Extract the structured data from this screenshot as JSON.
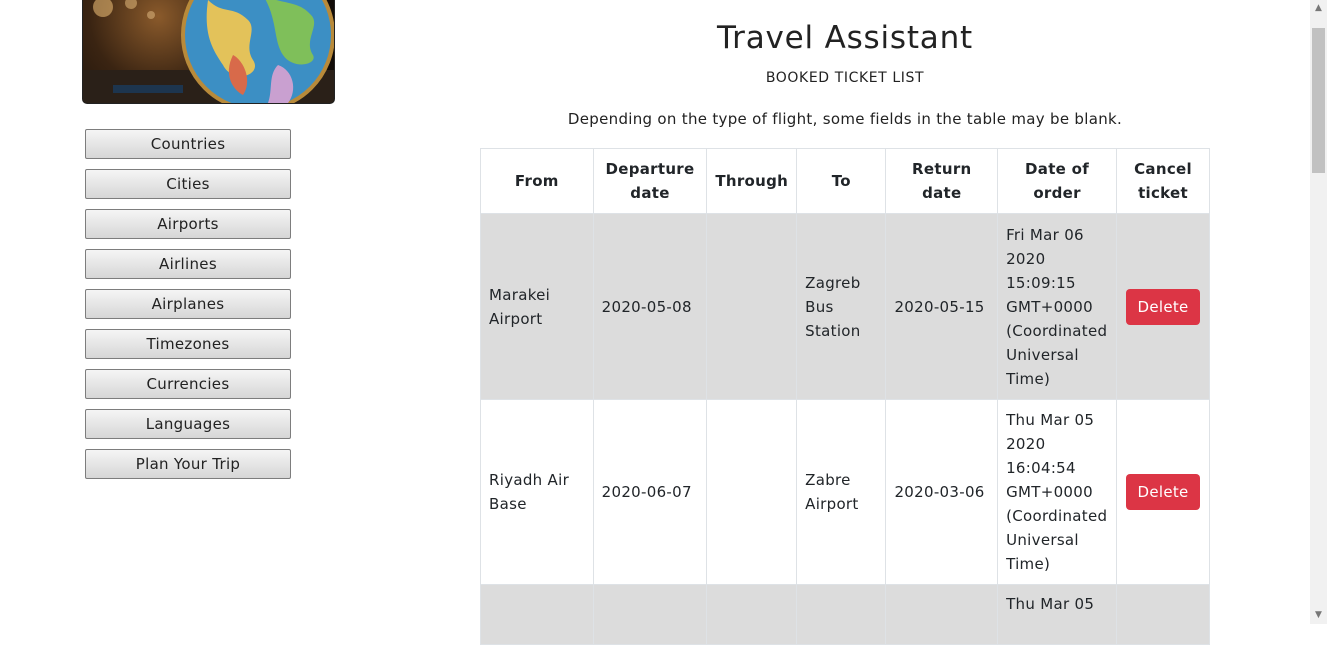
{
  "header": {
    "title": "Travel Assistant",
    "subtitle": "BOOKED TICKET LIST",
    "note": "Depending on the type of flight, some fields in the table may be blank."
  },
  "sidebar": {
    "items": [
      {
        "label": "Countries"
      },
      {
        "label": "Cities"
      },
      {
        "label": "Airports"
      },
      {
        "label": "Airlines"
      },
      {
        "label": "Airplanes"
      },
      {
        "label": "Timezones"
      },
      {
        "label": "Currencies"
      },
      {
        "label": "Languages"
      },
      {
        "label": "Plan Your Trip"
      }
    ]
  },
  "table": {
    "columns": [
      "From",
      "Departure date",
      "Through",
      "To",
      "Return date",
      "Date of order",
      "Cancel ticket"
    ],
    "rows": [
      {
        "from": "Marakei Airport",
        "departure": "2020-05-08",
        "through": "",
        "to": "Zagreb Bus Station",
        "return": "2020-05-15",
        "ordered": "Fri Mar 06 2020 15:09:15 GMT+0000 (Coordinated Universal Time)",
        "action": "Delete"
      },
      {
        "from": "Riyadh Air Base",
        "departure": "2020-06-07",
        "through": "",
        "to": "Zabre Airport",
        "return": "2020-03-06",
        "ordered": "Thu Mar 05 2020 16:04:54 GMT+0000 (Coordinated Universal Time)",
        "action": "Delete"
      },
      {
        "from": "",
        "departure": "",
        "through": "",
        "to": "",
        "return": "",
        "ordered": "Thu Mar 05",
        "action": ""
      }
    ]
  },
  "icons": {
    "scroll_up": "scroll-up-arrow-icon",
    "scroll_down": "scroll-down-arrow-icon"
  },
  "colors": {
    "delete": "#dc3545",
    "row_shaded": "#dcdcdc"
  }
}
